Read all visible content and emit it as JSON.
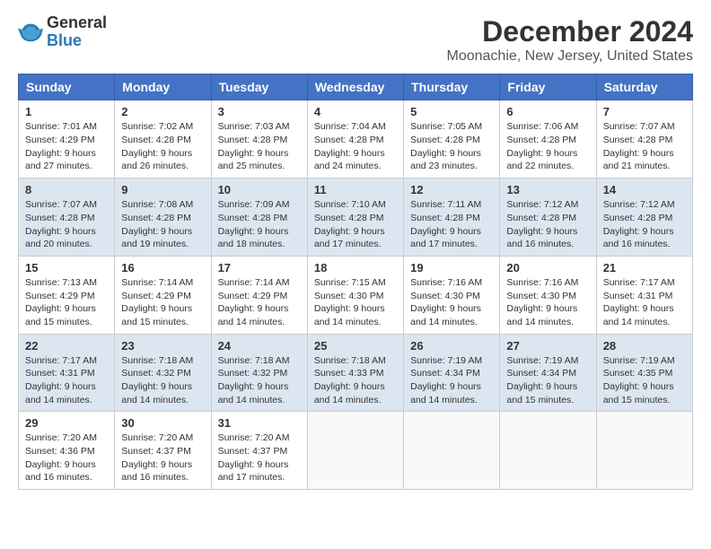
{
  "logo": {
    "general": "General",
    "blue": "Blue"
  },
  "header": {
    "title": "December 2024",
    "subtitle": "Moonachie, New Jersey, United States"
  },
  "weekdays": [
    "Sunday",
    "Monday",
    "Tuesday",
    "Wednesday",
    "Thursday",
    "Friday",
    "Saturday"
  ],
  "weeks": [
    [
      {
        "day": "1",
        "sunrise": "Sunrise: 7:01 AM",
        "sunset": "Sunset: 4:29 PM",
        "daylight": "Daylight: 9 hours and 27 minutes."
      },
      {
        "day": "2",
        "sunrise": "Sunrise: 7:02 AM",
        "sunset": "Sunset: 4:28 PM",
        "daylight": "Daylight: 9 hours and 26 minutes."
      },
      {
        "day": "3",
        "sunrise": "Sunrise: 7:03 AM",
        "sunset": "Sunset: 4:28 PM",
        "daylight": "Daylight: 9 hours and 25 minutes."
      },
      {
        "day": "4",
        "sunrise": "Sunrise: 7:04 AM",
        "sunset": "Sunset: 4:28 PM",
        "daylight": "Daylight: 9 hours and 24 minutes."
      },
      {
        "day": "5",
        "sunrise": "Sunrise: 7:05 AM",
        "sunset": "Sunset: 4:28 PM",
        "daylight": "Daylight: 9 hours and 23 minutes."
      },
      {
        "day": "6",
        "sunrise": "Sunrise: 7:06 AM",
        "sunset": "Sunset: 4:28 PM",
        "daylight": "Daylight: 9 hours and 22 minutes."
      },
      {
        "day": "7",
        "sunrise": "Sunrise: 7:07 AM",
        "sunset": "Sunset: 4:28 PM",
        "daylight": "Daylight: 9 hours and 21 minutes."
      }
    ],
    [
      {
        "day": "8",
        "sunrise": "Sunrise: 7:07 AM",
        "sunset": "Sunset: 4:28 PM",
        "daylight": "Daylight: 9 hours and 20 minutes."
      },
      {
        "day": "9",
        "sunrise": "Sunrise: 7:08 AM",
        "sunset": "Sunset: 4:28 PM",
        "daylight": "Daylight: 9 hours and 19 minutes."
      },
      {
        "day": "10",
        "sunrise": "Sunrise: 7:09 AM",
        "sunset": "Sunset: 4:28 PM",
        "daylight": "Daylight: 9 hours and 18 minutes."
      },
      {
        "day": "11",
        "sunrise": "Sunrise: 7:10 AM",
        "sunset": "Sunset: 4:28 PM",
        "daylight": "Daylight: 9 hours and 17 minutes."
      },
      {
        "day": "12",
        "sunrise": "Sunrise: 7:11 AM",
        "sunset": "Sunset: 4:28 PM",
        "daylight": "Daylight: 9 hours and 17 minutes."
      },
      {
        "day": "13",
        "sunrise": "Sunrise: 7:12 AM",
        "sunset": "Sunset: 4:28 PM",
        "daylight": "Daylight: 9 hours and 16 minutes."
      },
      {
        "day": "14",
        "sunrise": "Sunrise: 7:12 AM",
        "sunset": "Sunset: 4:28 PM",
        "daylight": "Daylight: 9 hours and 16 minutes."
      }
    ],
    [
      {
        "day": "15",
        "sunrise": "Sunrise: 7:13 AM",
        "sunset": "Sunset: 4:29 PM",
        "daylight": "Daylight: 9 hours and 15 minutes."
      },
      {
        "day": "16",
        "sunrise": "Sunrise: 7:14 AM",
        "sunset": "Sunset: 4:29 PM",
        "daylight": "Daylight: 9 hours and 15 minutes."
      },
      {
        "day": "17",
        "sunrise": "Sunrise: 7:14 AM",
        "sunset": "Sunset: 4:29 PM",
        "daylight": "Daylight: 9 hours and 14 minutes."
      },
      {
        "day": "18",
        "sunrise": "Sunrise: 7:15 AM",
        "sunset": "Sunset: 4:30 PM",
        "daylight": "Daylight: 9 hours and 14 minutes."
      },
      {
        "day": "19",
        "sunrise": "Sunrise: 7:16 AM",
        "sunset": "Sunset: 4:30 PM",
        "daylight": "Daylight: 9 hours and 14 minutes."
      },
      {
        "day": "20",
        "sunrise": "Sunrise: 7:16 AM",
        "sunset": "Sunset: 4:30 PM",
        "daylight": "Daylight: 9 hours and 14 minutes."
      },
      {
        "day": "21",
        "sunrise": "Sunrise: 7:17 AM",
        "sunset": "Sunset: 4:31 PM",
        "daylight": "Daylight: 9 hours and 14 minutes."
      }
    ],
    [
      {
        "day": "22",
        "sunrise": "Sunrise: 7:17 AM",
        "sunset": "Sunset: 4:31 PM",
        "daylight": "Daylight: 9 hours and 14 minutes."
      },
      {
        "day": "23",
        "sunrise": "Sunrise: 7:18 AM",
        "sunset": "Sunset: 4:32 PM",
        "daylight": "Daylight: 9 hours and 14 minutes."
      },
      {
        "day": "24",
        "sunrise": "Sunrise: 7:18 AM",
        "sunset": "Sunset: 4:32 PM",
        "daylight": "Daylight: 9 hours and 14 minutes."
      },
      {
        "day": "25",
        "sunrise": "Sunrise: 7:18 AM",
        "sunset": "Sunset: 4:33 PM",
        "daylight": "Daylight: 9 hours and 14 minutes."
      },
      {
        "day": "26",
        "sunrise": "Sunrise: 7:19 AM",
        "sunset": "Sunset: 4:34 PM",
        "daylight": "Daylight: 9 hours and 14 minutes."
      },
      {
        "day": "27",
        "sunrise": "Sunrise: 7:19 AM",
        "sunset": "Sunset: 4:34 PM",
        "daylight": "Daylight: 9 hours and 15 minutes."
      },
      {
        "day": "28",
        "sunrise": "Sunrise: 7:19 AM",
        "sunset": "Sunset: 4:35 PM",
        "daylight": "Daylight: 9 hours and 15 minutes."
      }
    ],
    [
      {
        "day": "29",
        "sunrise": "Sunrise: 7:20 AM",
        "sunset": "Sunset: 4:36 PM",
        "daylight": "Daylight: 9 hours and 16 minutes."
      },
      {
        "day": "30",
        "sunrise": "Sunrise: 7:20 AM",
        "sunset": "Sunset: 4:37 PM",
        "daylight": "Daylight: 9 hours and 16 minutes."
      },
      {
        "day": "31",
        "sunrise": "Sunrise: 7:20 AM",
        "sunset": "Sunset: 4:37 PM",
        "daylight": "Daylight: 9 hours and 17 minutes."
      },
      null,
      null,
      null,
      null
    ]
  ]
}
